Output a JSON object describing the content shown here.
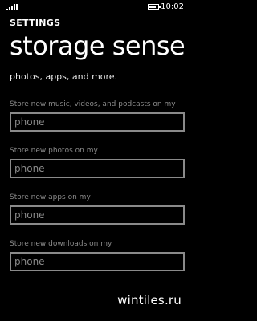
{
  "status_bar": {
    "time": "10:02",
    "signal_icon": "signal-strength-icon",
    "battery_icon": "battery-icon"
  },
  "header": {
    "app_title": "SETTINGS",
    "page_title": "storage sense"
  },
  "content": {
    "partial_text": "photos, apps, and more.",
    "settings": [
      {
        "label": "Store new music, videos, and podcasts on my",
        "value": "phone"
      },
      {
        "label": "Store new photos on my",
        "value": "phone"
      },
      {
        "label": "Store new apps on my",
        "value": "phone"
      },
      {
        "label": "Store new downloads on my",
        "value": "phone"
      }
    ]
  },
  "watermark": "wintiles.ru"
}
